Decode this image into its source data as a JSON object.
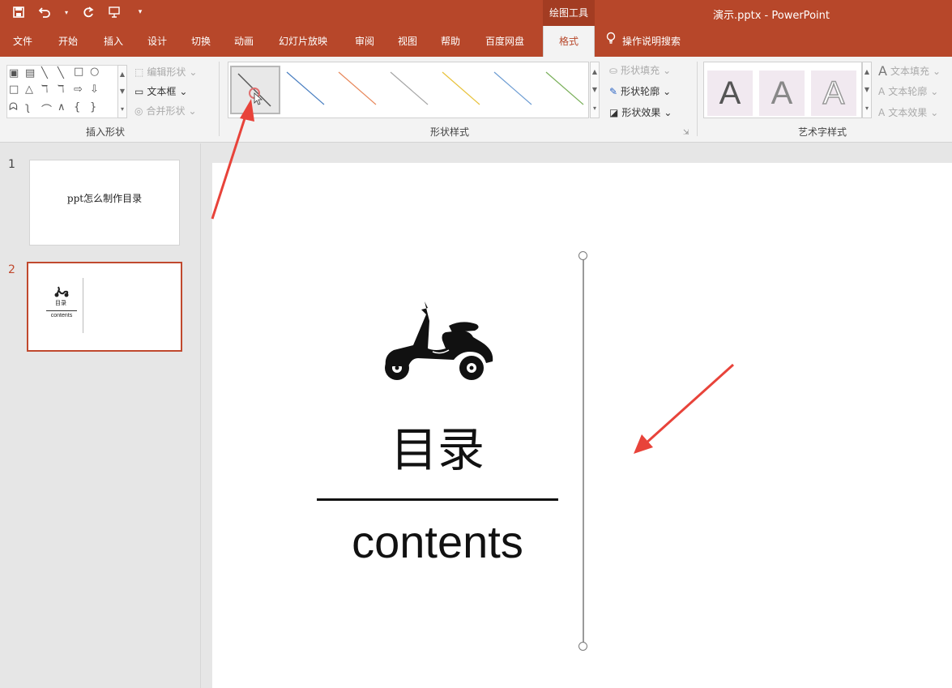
{
  "titlebar": {
    "context_group": "绘图工具",
    "doc_title": "演示.pptx  -  PowerPoint",
    "qat_icons": [
      "save-icon",
      "undo-icon",
      "redo-icon",
      "present-icon",
      "customize-icon"
    ]
  },
  "tabs": [
    {
      "label": "文件"
    },
    {
      "label": "开始"
    },
    {
      "label": "插入"
    },
    {
      "label": "设计"
    },
    {
      "label": "切换"
    },
    {
      "label": "动画"
    },
    {
      "label": "幻灯片放映"
    },
    {
      "label": "审阅"
    },
    {
      "label": "视图"
    },
    {
      "label": "帮助"
    },
    {
      "label": "百度网盘"
    },
    {
      "label": "格式"
    }
  ],
  "tell_me": "操作说明搜索",
  "ribbon": {
    "insert_shapes": {
      "label": "插入形状",
      "edit_shape": "编辑形状",
      "text_box": "文本框",
      "merge_shapes": "合并形状"
    },
    "shape_styles": {
      "label": "形状样式",
      "fill": "形状填充",
      "outline": "形状轮廓",
      "effects": "形状效果",
      "swatch_colors": [
        "#555555",
        "#4a7fc1",
        "#e8875a",
        "#a5a5a5",
        "#e8c23a",
        "#6b9bd2",
        "#7ab05a"
      ]
    },
    "wordart_styles": {
      "label": "艺术字样式",
      "letter": "A",
      "text_fill": "文本填充",
      "text_outline": "文本轮廓",
      "text_effects": "文本效果"
    }
  },
  "thumbnails": [
    {
      "number": "1",
      "title": "ppt怎么制作目录"
    },
    {
      "number": "2",
      "title": "目录",
      "subtitle": "contents"
    }
  ],
  "slide": {
    "title": "目录",
    "subtitle": "contents"
  },
  "colors": {
    "accent": "#b7472a",
    "arrow": "#e8433a"
  }
}
